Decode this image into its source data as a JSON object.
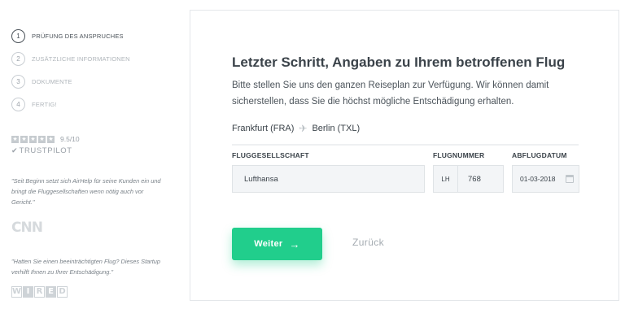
{
  "steps": [
    {
      "num": "1",
      "label": "PRÜFUNG DES ANSPRUCHES"
    },
    {
      "num": "2",
      "label": "ZUSÄTZLICHE INFORMATIONEN"
    },
    {
      "num": "3",
      "label": "DOKUMENTE"
    },
    {
      "num": "4",
      "label": "FERTIG!"
    }
  ],
  "trustpilot": {
    "rating_stars": 5,
    "score": "9.5/10",
    "name": "TRUSTPILOT",
    "star_glyph": "★",
    "check_glyph": "✔"
  },
  "quotes": [
    {
      "text": "\"Seit Beginn setzt sich AirHelp für seine Kunden ein und bringt die Fluggesellschaften wenn nötig auch vor Gericht.\"",
      "source": "CNN"
    },
    {
      "text": "\"Hatten Sie einen beeinträchtigten Flug? Dieses Startup verhilft Ihnen zu Ihrer Entschädigung.\"",
      "source": "WIRED"
    }
  ],
  "form": {
    "title": "Letzter Schritt, Angaben zu Ihrem betroffenen Flug",
    "description": "Bitte stellen Sie uns den ganzen Reiseplan zur Verfügung. Wir können damit sicherstellen, dass Sie die höchst mögliche Entschädigung erhalten.",
    "route": {
      "from": "Frankfurt (FRA)",
      "to": "Berlin (TXL)",
      "icon": "airplane-icon"
    },
    "labels": {
      "airline": "FLUGGESELLSCHAFT",
      "flight_number": "FLUGNUMMER",
      "departure_date": "ABFLUGDATUM"
    },
    "values": {
      "airline": "Lufthansa",
      "flight_prefix": "LH",
      "flight_number": "768",
      "departure_date": "01-03-2018"
    },
    "buttons": {
      "next": "Weiter",
      "next_arrow": "→",
      "back": "Zurück"
    }
  },
  "colors": {
    "accent": "#21ce8c",
    "text": "#3b434a",
    "muted": "#a4abb1"
  }
}
